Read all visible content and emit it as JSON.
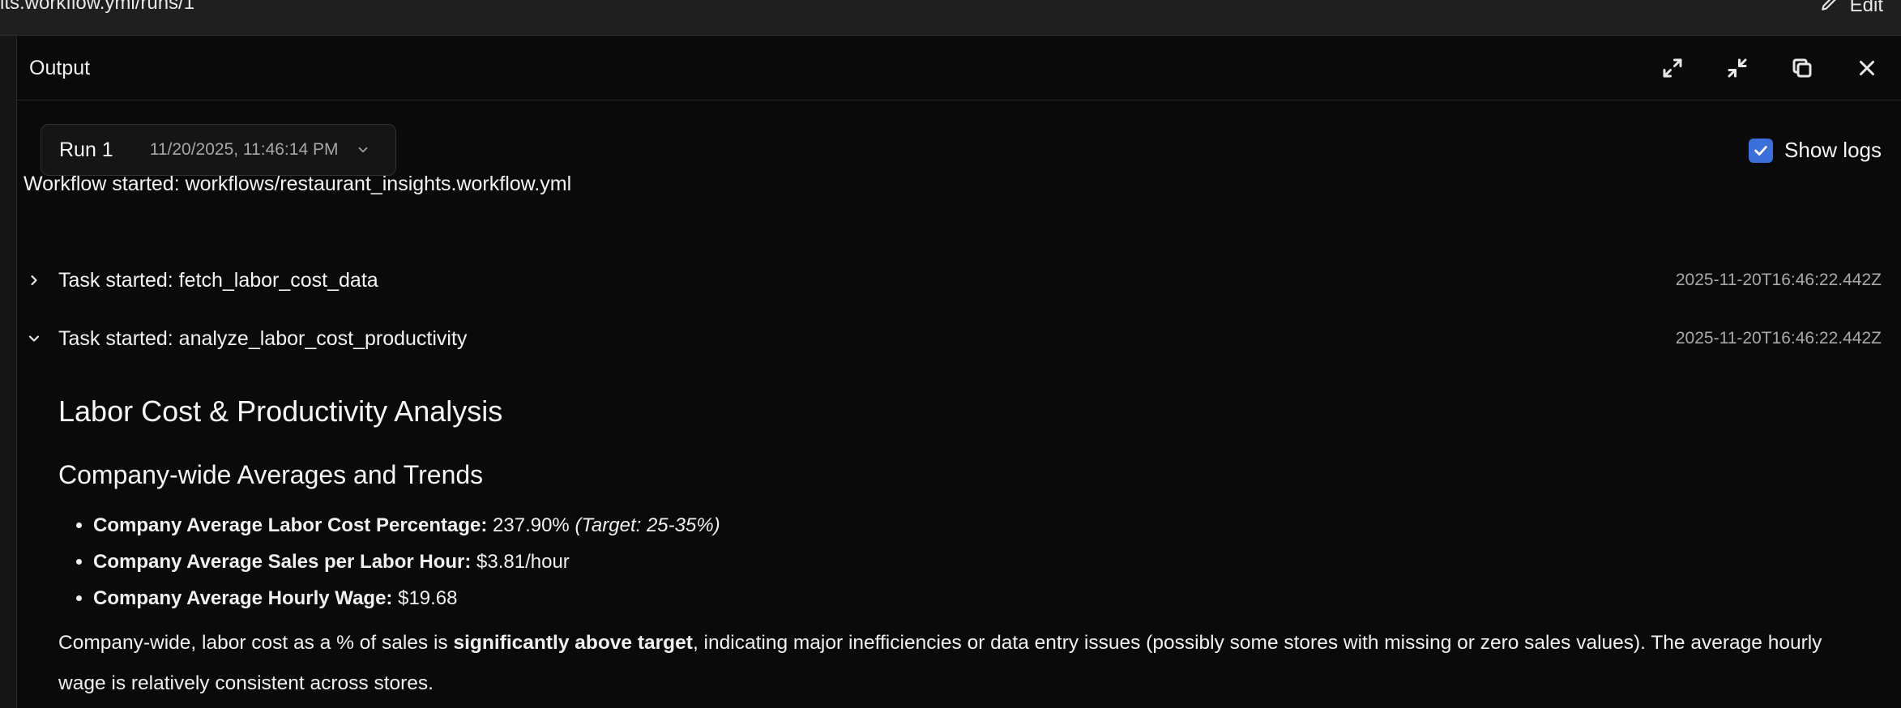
{
  "topbar": {
    "path": "its.workflow.yml/runs/1",
    "edit_label": "Edit"
  },
  "panel": {
    "title": "Output",
    "icons": [
      "expand-icon",
      "collapse-icon",
      "copy-icon",
      "close-icon"
    ]
  },
  "run_select": {
    "label": "Run 1",
    "date": "11/20/2025, 11:46:14 PM"
  },
  "show_logs": {
    "label": "Show logs",
    "checked": true,
    "color": "#3b6fd9"
  },
  "log": {
    "workflow_started": "Workflow started: workflows/restaurant_insights.workflow.yml",
    "tasks": [
      {
        "label": "Task started: fetch_labor_cost_data",
        "timestamp": "2025-11-20T16:46:22.442Z",
        "expanded": false
      },
      {
        "label": "Task started: analyze_labor_cost_productivity",
        "timestamp": "2025-11-20T16:46:22.442Z",
        "expanded": true
      }
    ]
  },
  "report": {
    "title": "Labor Cost & Productivity Analysis",
    "subtitle": "Company-wide Averages and Trends",
    "bullets": [
      {
        "key": "Company Average Labor Cost Percentage:",
        "value": " 237.90% ",
        "note": "(Target: 25-35%)"
      },
      {
        "key": "Company Average Sales per Labor Hour:",
        "value": " $3.81/hour",
        "note": ""
      },
      {
        "key": "Company Average Hourly Wage:",
        "value": " $19.68",
        "note": ""
      }
    ],
    "paragraph": {
      "pre": "Company-wide, labor cost as a % of sales is ",
      "bold": "significantly above target",
      "post": ", indicating major inefficiencies or data entry issues (possibly some stores with missing or zero sales values). The average hourly wage is relatively consistent across stores."
    }
  }
}
